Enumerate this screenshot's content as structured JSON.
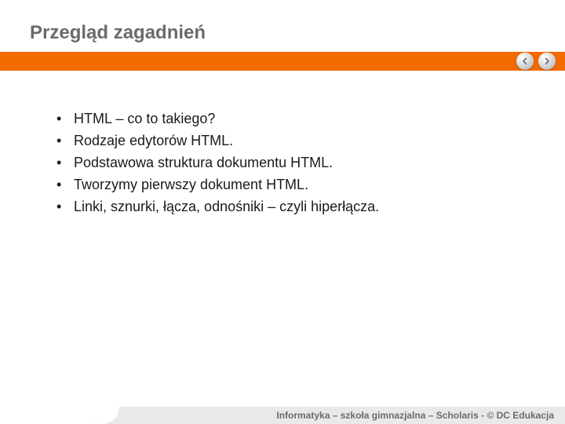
{
  "title": "Przegląd zagadnień",
  "bullets": {
    "b0": "HTML – co to takiego?",
    "b1": "Rodzaje edytorów HTML.",
    "b2": "Podstawowa struktura dokumentu HTML.",
    "b3": "Tworzymy pierwszy dokument HTML.",
    "b4": "Linki, sznurki, łącza, odnośniki – czyli hiperłącza."
  },
  "footer": "Informatyka – szkoła gimnazjalna – Scholaris - © DC Edukacja"
}
